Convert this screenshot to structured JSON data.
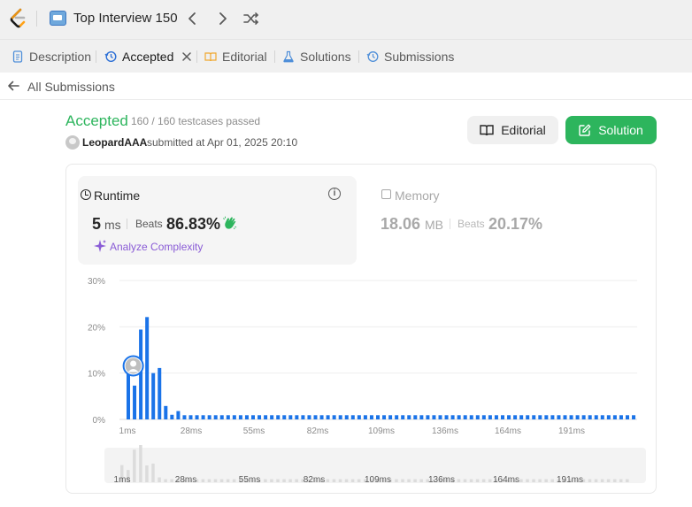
{
  "header": {
    "list_title": "Top Interview 150"
  },
  "tabs": [
    {
      "label": "Description"
    },
    {
      "label": "Accepted"
    },
    {
      "label": "Editorial"
    },
    {
      "label": "Solutions"
    },
    {
      "label": "Submissions"
    }
  ],
  "back": {
    "label": "All Submissions"
  },
  "result": {
    "status": "Accepted",
    "testcases": "160 / 160 testcases passed",
    "username": "LeopardAAA",
    "submitted": "submitted at Apr 01, 2025 20:10"
  },
  "buttons": {
    "editorial": "Editorial",
    "solution": "Solution"
  },
  "runtime": {
    "title": "Runtime",
    "value": "5",
    "unit": "ms",
    "beats_label": "Beats",
    "beats_pct": "86.83%",
    "analyze": "Analyze Complexity"
  },
  "memory": {
    "title": "Memory",
    "value": "18.06",
    "unit": "MB",
    "beats_label": "Beats",
    "beats_pct": "20.17%"
  },
  "colors": {
    "accepted": "#2db55d",
    "bar": "#1a73e8",
    "analyze": "#8a5cd6"
  },
  "chart_data": {
    "type": "bar",
    "y_tick_labels": [
      "30%",
      "20%",
      "10%",
      "0%"
    ],
    "y_ticks": [
      30,
      20,
      10,
      0
    ],
    "ylim": [
      0,
      30
    ],
    "x_tick_labels": [
      "1ms",
      "28ms",
      "55ms",
      "82ms",
      "109ms",
      "136ms",
      "164ms",
      "191ms"
    ],
    "user_bar_index": 2,
    "values": [
      10.2,
      7.3,
      19.4,
      22.1,
      10.0,
      11.1,
      2.9,
      1.0,
      1.8,
      0.9,
      0.9,
      0.9,
      0.9,
      0.9,
      0.9,
      0.9,
      0.9,
      0.9,
      0.9,
      0.9,
      0.9,
      0.9,
      0.9,
      0.9,
      0.9,
      0.9,
      0.9,
      0.9,
      0.9,
      0.9,
      0.9,
      0.9,
      0.9,
      0.9,
      0.9,
      0.9,
      0.9,
      0.9,
      0.9,
      0.9,
      0.9,
      0.9,
      0.9,
      0.9,
      0.9,
      0.9,
      0.9,
      0.9,
      0.9,
      0.9,
      0.9,
      0.9,
      0.9,
      0.9,
      0.9,
      0.9,
      0.9,
      0.9,
      0.9,
      0.9,
      0.9,
      0.9,
      0.9,
      0.9,
      0.9,
      0.9,
      0.9,
      0.9,
      0.9,
      0.9,
      0.9,
      0.9,
      0.9,
      0.9,
      0.9,
      0.9,
      0.9,
      0.9,
      0.9,
      0.9,
      0.9,
      0.9
    ]
  }
}
